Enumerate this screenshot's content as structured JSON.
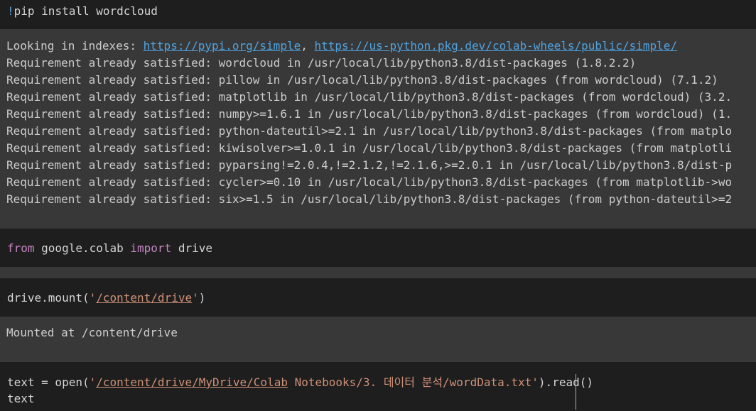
{
  "cells": {
    "pip": {
      "bang": "!",
      "command": "pip install wordcloud",
      "output": {
        "indexes_prefix": "Looking in indexes: ",
        "index_url_1": "https://pypi.org/simple",
        "separator": ", ",
        "index_url_2": "https://us-python.pkg.dev/colab-wheels/public/simple/",
        "lines": [
          "Requirement already satisfied: wordcloud in /usr/local/lib/python3.8/dist-packages (1.8.2.2)",
          "Requirement already satisfied: pillow in /usr/local/lib/python3.8/dist-packages (from wordcloud) (7.1.2)",
          "Requirement already satisfied: matplotlib in /usr/local/lib/python3.8/dist-packages (from wordcloud) (3.2.",
          "Requirement already satisfied: numpy>=1.6.1 in /usr/local/lib/python3.8/dist-packages (from wordcloud) (1.",
          "Requirement already satisfied: python-dateutil>=2.1 in /usr/local/lib/python3.8/dist-packages (from matplo",
          "Requirement already satisfied: kiwisolver>=1.0.1 in /usr/local/lib/python3.8/dist-packages (from matplotli",
          "Requirement already satisfied: pyparsing!=2.0.4,!=2.1.2,!=2.1.6,>=2.0.1 in /usr/local/lib/python3.8/dist-p",
          "Requirement already satisfied: cycler>=0.10 in /usr/local/lib/python3.8/dist-packages (from matplotlib->wo",
          "Requirement already satisfied: six>=1.5 in /usr/local/lib/python3.8/dist-packages (from python-dateutil>=2"
        ]
      }
    },
    "import": {
      "kw_from": "from",
      "module": " google.colab ",
      "kw_import": "import",
      "name": " drive"
    },
    "mount": {
      "call_prefix": "drive.mount(",
      "quote_open": "'",
      "path": "/content/drive",
      "quote_close": "'",
      "call_suffix": ")",
      "output": "Mounted at /content/drive"
    },
    "read": {
      "line1_prefix": "text = open(",
      "quote_open": "'",
      "path_link": "/content/drive/MyDrive/Colab",
      "path_rest": " Notebooks/3. 데이터 분석/wordData.txt",
      "quote_close": "'",
      "line1_suffix": ").read()",
      "line2": "text"
    }
  },
  "colors": {
    "cell_bg": "#1e1e1e",
    "output_bg": "#383838",
    "keyword": "#c586c0",
    "string": "#ce9178",
    "link": "#4fa3e0"
  }
}
